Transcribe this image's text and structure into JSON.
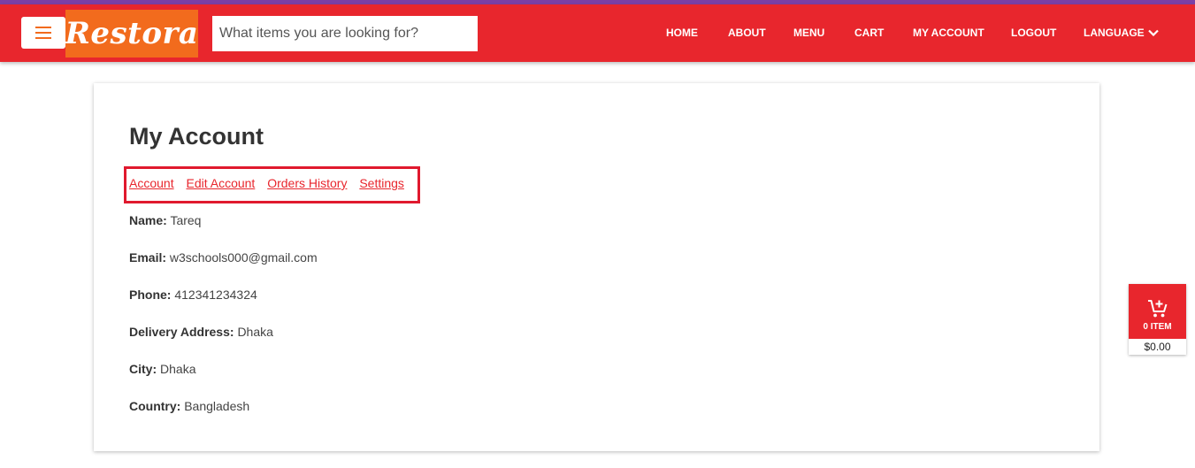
{
  "brand": {
    "logo_text": "Restora"
  },
  "search": {
    "placeholder": "What items you are looking for?"
  },
  "nav": {
    "home": "HOME",
    "about": "ABOUT",
    "menu": "MENU",
    "cart": "CART",
    "my_account": "MY ACCOUNT",
    "logout": "LOGOUT",
    "language": "LANGUAGE"
  },
  "page": {
    "title": "My Account"
  },
  "tabs": {
    "account": "Account",
    "edit_account": "Edit Account",
    "orders_history": "Orders History",
    "settings": "Settings"
  },
  "profile": {
    "name": {
      "label": "Name:",
      "value": "Tareq"
    },
    "email": {
      "label": "Email:",
      "value": "w3schools000@gmail.com"
    },
    "phone": {
      "label": "Phone:",
      "value": "412341234324"
    },
    "address": {
      "label": "Delivery Address:",
      "value": "Dhaka"
    },
    "city": {
      "label": "City:",
      "value": "Dhaka"
    },
    "country": {
      "label": "Country:",
      "value": "Bangladesh"
    }
  },
  "cart_widget": {
    "count_label": "0 ITEM",
    "total": "$0.00"
  },
  "colors": {
    "primary": "#e8262d",
    "logo_bg": "#f26b1d",
    "top_strip": "#7b3fa6",
    "highlight": "#e0192e"
  },
  "icons": {
    "menu": "hamburger-icon",
    "language": "chevron-down-icon",
    "cart": "cart-add-icon"
  }
}
